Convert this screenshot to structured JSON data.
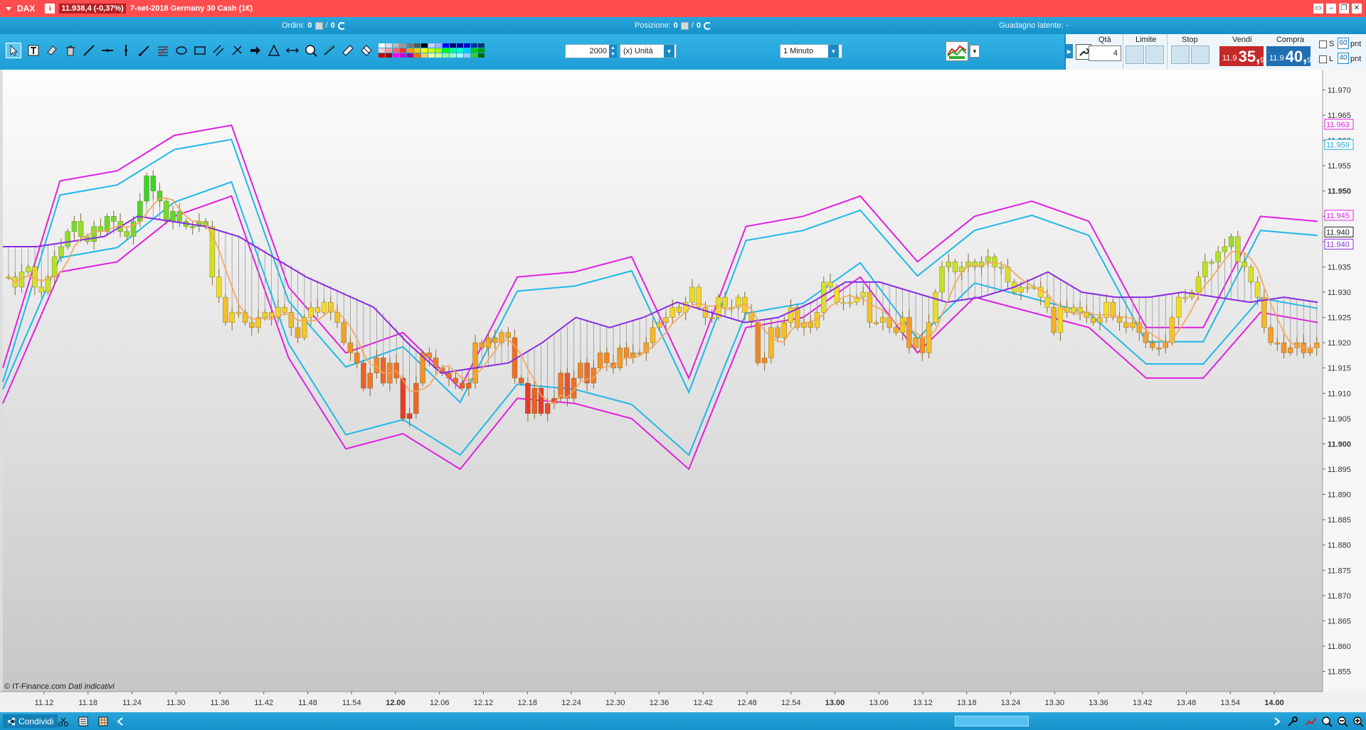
{
  "titlebar": {
    "symbol": "DAX",
    "price_change": "11.938,4 (-0,37%)",
    "instrument": "7-set-2018 Germany 30 Cash (1€)",
    "info_glyph": "i",
    "window_buttons": [
      "▭",
      "–",
      "❐",
      "✕"
    ]
  },
  "status": {
    "ordini_label": "Ordini:",
    "ordini_value": "0",
    "ordini_sep": "/",
    "ordini_value2": "0",
    "posizione_label": "Posizione:",
    "posizione_value": "0",
    "posizione_sep": "/",
    "posizione_value2": "0",
    "guadagno_label": "Guadagno latente:",
    "guadagno_value": "-"
  },
  "toolbar": {
    "units_value": "2000",
    "units_type": "(x) Unità",
    "timeframe": "1 Minuto"
  },
  "order_panel": {
    "qty_label": "Qtà",
    "qty_value": "4",
    "limit_label": "Limite",
    "stop_label": "Stop",
    "sell_label": "Vendi",
    "buy_label": "Compra",
    "sell_prefix": "11.9",
    "sell_big": "35,",
    "sell_sup": "9",
    "buy_prefix": "11.9",
    "buy_big": "40,",
    "buy_sup": "9",
    "s_label": "S",
    "s_value": "60",
    "l_label": "L",
    "l_value": "40",
    "pnt": "pnt",
    "pnt2": "pnt"
  },
  "chart_data": {
    "type": "candlestick",
    "x_ticks": [
      "11.12",
      "11.18",
      "11.24",
      "11.30",
      "11.36",
      "11.42",
      "11.48",
      "11.54",
      "12.00",
      "12.06",
      "12.12",
      "12.18",
      "12.24",
      "12.30",
      "12.36",
      "12.42",
      "12.48",
      "12.54",
      "13.00",
      "13.06",
      "13.12",
      "13.18",
      "13.24",
      "13.30",
      "13.36",
      "13.42",
      "13.48",
      "13.54",
      "14.00"
    ],
    "x_ticks_bold": [
      "12.00",
      "13.00",
      "14.00"
    ],
    "y_ticks": [
      "11.970",
      "11.965",
      "11.960",
      "11.955",
      "11.950",
      "11.945",
      "11.940",
      "11.935",
      "11.930",
      "11.925",
      "11.920",
      "11.915",
      "11.910",
      "11.905",
      "11.900",
      "11.895",
      "11.890",
      "11.885",
      "11.880",
      "11.875",
      "11.870",
      "11.865",
      "11.860",
      "11.855"
    ],
    "y_ticks_bold": [
      "11.950",
      "11.900"
    ],
    "ylim": [
      11851,
      11974
    ],
    "right_labels": [
      {
        "text": "11.963",
        "color": "#e020e0",
        "value": 11963.2
      },
      {
        "text": "11.959",
        "color": "#22a8e0",
        "value": 11959.2
      },
      {
        "text": "11.945",
        "color": "#e020e0",
        "value": 11945.2
      },
      {
        "text": "11.940",
        "color": "#222222",
        "value": 11941.9
      },
      {
        "text": "11.940",
        "color": "#8a2be2",
        "value": 11939.5
      }
    ],
    "closes": [
      11933,
      11931,
      11934,
      11935,
      11931,
      11930,
      11933,
      11937,
      11939,
      11942,
      11944,
      11941,
      11940,
      11943,
      11942,
      11945,
      11944,
      11942,
      11941,
      11944,
      11948,
      11953,
      11950,
      11948,
      11944,
      11946,
      11944,
      11943,
      11943,
      11944,
      11943,
      11933,
      11929,
      11924,
      11926,
      11926,
      11924,
      11923,
      11925,
      11926,
      11925,
      11927,
      11926,
      11923,
      11921,
      11925,
      11927,
      11926,
      11928,
      11926,
      11924,
      11920,
      11918,
      11916,
      11911,
      11914,
      11917,
      11912,
      11916,
      11913,
      11905,
      11906,
      11912,
      11918,
      11917,
      11915,
      11914,
      11913,
      11912,
      11911,
      11912,
      11920,
      11919,
      11921,
      11920,
      11922,
      11921,
      11913,
      11912,
      11906,
      11911,
      11906,
      11908,
      11909,
      11914,
      11909,
      11913,
      11916,
      11912,
      11915,
      11918,
      11916,
      11915,
      11919,
      11917,
      11918,
      11918,
      11920,
      11923,
      11924,
      11925,
      11927,
      11926,
      11928,
      11931,
      11927,
      11925,
      11925,
      11929,
      11927,
      11927,
      11929,
      11926,
      11924,
      11916,
      11917,
      11923,
      11921,
      11924,
      11927,
      11923,
      11924,
      11923,
      11926,
      11932,
      11931,
      11928,
      11928,
      11928,
      11929,
      11930,
      11924,
      11924,
      11925,
      11923,
      11922,
      11925,
      11919,
      11921,
      11918,
      11924,
      11930,
      11935,
      11936,
      11934,
      11935,
      11936,
      11935,
      11936,
      11937,
      11935,
      11935,
      11932,
      11930,
      11931,
      11931,
      11931,
      11929,
      11927,
      11922,
      11927,
      11926,
      11927,
      11926,
      11925,
      11924,
      11925,
      11928,
      11925,
      11924,
      11923,
      11924,
      11922,
      11920,
      11919,
      11919,
      11920,
      11925,
      11929,
      11929,
      11930,
      11933,
      11936,
      11936,
      11938,
      11939,
      11941,
      11936,
      11935,
      11932,
      11929,
      11923,
      11920,
      11920,
      11918,
      11919,
      11920,
      11918,
      11919,
      11920
    ],
    "vwap": [
      11939,
      11939,
      11940,
      11941,
      11945,
      11944,
      11943,
      11941,
      11937,
      11933,
      11930,
      11927,
      11920,
      11914,
      11915,
      11916,
      11920,
      11925,
      11923,
      11925,
      11928,
      11926,
      11924,
      11925,
      11928,
      11932,
      11932,
      11930,
      11928,
      11929,
      11931,
      11934,
      11930,
      11929,
      11929,
      11930,
      11929,
      11928,
      11929,
      11928
    ],
    "upper_outer": [
      11915,
      11952,
      11954,
      11961,
      11963,
      11931,
      11918,
      11922,
      11911,
      11933,
      11934,
      11937,
      11913,
      11943,
      11945,
      11949,
      11936,
      11945,
      11948,
      11944,
      11923,
      11923,
      11945,
      11944
    ],
    "lower_outer": [
      11908,
      11934,
      11936,
      11945,
      11949,
      11917,
      11899,
      11902,
      11895,
      11909,
      11908,
      11905,
      11895,
      11923,
      11925,
      11933,
      11918,
      11929,
      11926,
      11923,
      11913,
      11913,
      11926,
      11924
    ]
  },
  "credit": {
    "source": "© IT-Finance.com",
    "note": "Dati indicativi"
  },
  "bottombar": {
    "share_label": "Condividi"
  }
}
